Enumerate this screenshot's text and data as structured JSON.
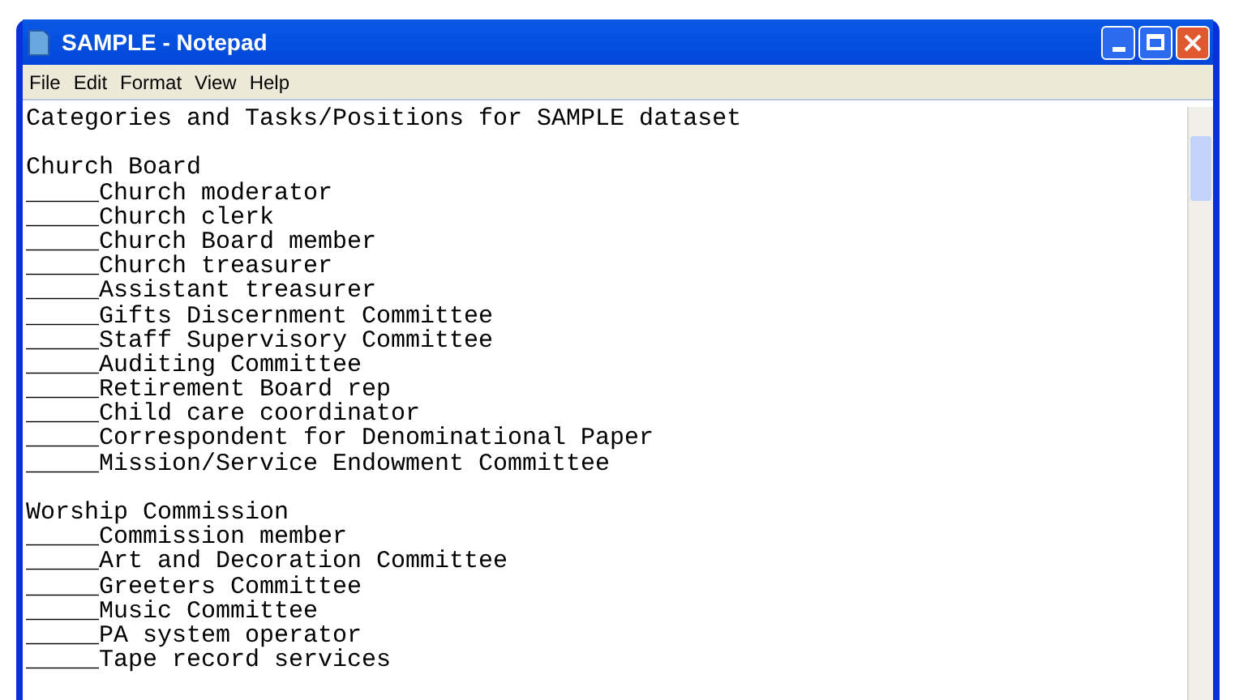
{
  "window": {
    "title": "SAMPLE - Notepad"
  },
  "menu": [
    "File",
    "Edit",
    "Format",
    "View",
    "Help"
  ],
  "document": {
    "title": "Categories and Tasks/Positions for SAMPLE dataset",
    "sections": [
      {
        "heading": "Church Board",
        "lines": [
          "_____Church moderator",
          "_____Church clerk",
          "_____Church Board member",
          "_____Church treasurer",
          "_____Assistant treasurer",
          "_____Gifts Discernment Committee",
          "_____Staff Supervisory Committee",
          "_____Auditing Committee",
          "_____Retirement Board rep",
          "_____Child care coordinator",
          "_____Correspondent for Denominational Paper",
          "_____Mission/Service Endowment Committee"
        ]
      },
      {
        "heading": "Worship Commission",
        "lines": [
          "_____Commission member",
          "_____Art and Decoration Committee",
          "_____Greeters Committee",
          "_____Music Committee",
          "_____PA system operator",
          "_____Tape record services"
        ]
      }
    ]
  }
}
